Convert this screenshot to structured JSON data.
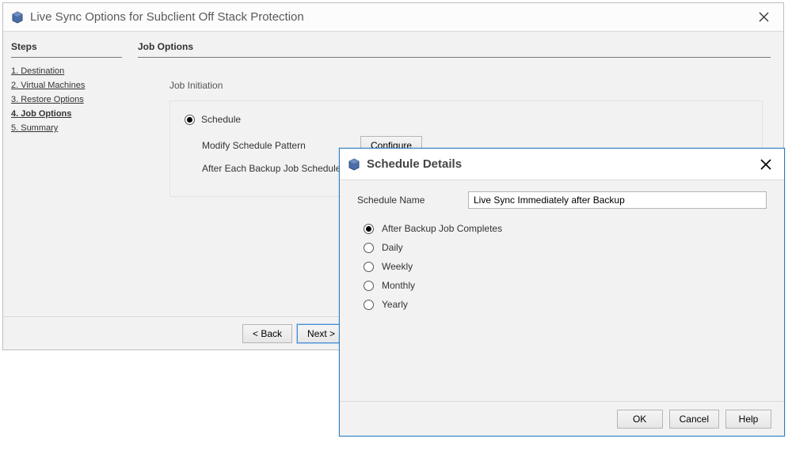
{
  "wizard": {
    "title": "Live Sync Options for Subclient Off Stack Protection",
    "steps_header": "Steps",
    "steps": [
      "1. Destination",
      "2. Virtual Machines",
      "3. Restore Options",
      "4. Job Options",
      "5. Summary"
    ],
    "active_step_index": 3,
    "panel_header": "Job Options",
    "job_init": {
      "group_title": "Job Initiation",
      "schedule_label": "Schedule",
      "modify_label": "Modify Schedule Pattern",
      "configure_label": "Configure",
      "after_each_label": "After Each Backup Job Schedule"
    },
    "footer": {
      "back": "< Back",
      "next": "Next >"
    }
  },
  "dialog": {
    "title": "Schedule Details",
    "schedule_name_label": "Schedule Name",
    "schedule_name_value": "Live Sync Immediately after Backup",
    "frequencies": [
      "After Backup Job Completes",
      "Daily",
      "Weekly",
      "Monthly",
      "Yearly"
    ],
    "selected_frequency_index": 0,
    "footer": {
      "ok": "OK",
      "cancel": "Cancel",
      "help": "Help"
    }
  }
}
